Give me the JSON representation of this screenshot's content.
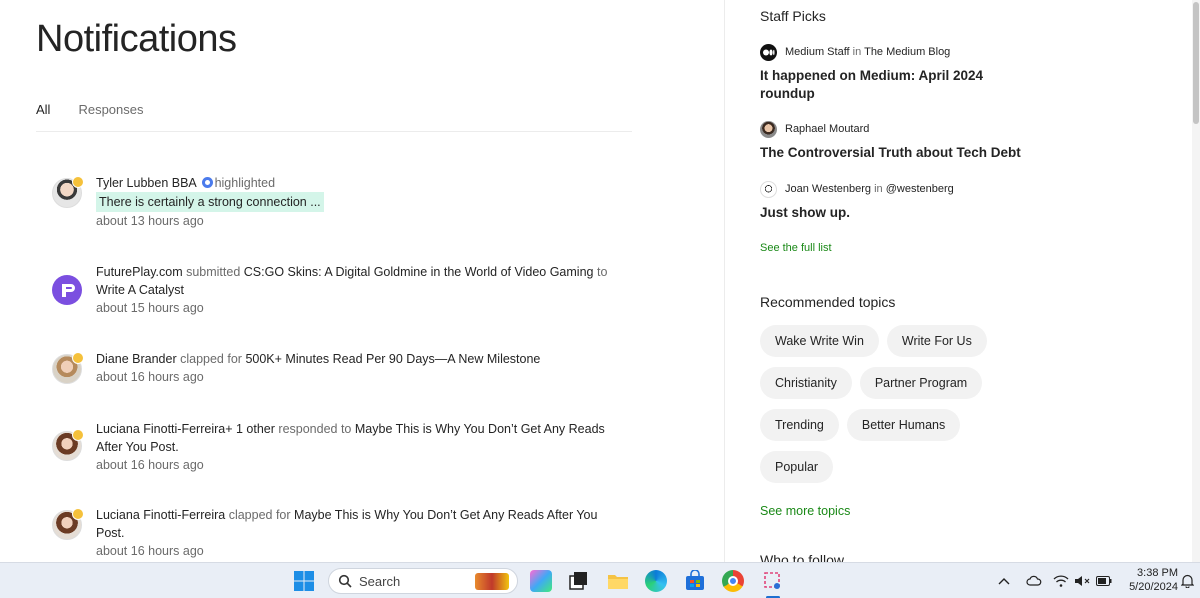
{
  "page": {
    "title": "Notifications"
  },
  "tabs": [
    {
      "label": "All"
    },
    {
      "label": "Responses"
    }
  ],
  "notifications": [
    {
      "actor": "Tyler Lubben BBA",
      "action": "highlighted",
      "highlight": "There is certainly a strong connection ...",
      "time": "about 13 hours ago"
    },
    {
      "actor": "FuturePlay.com",
      "action": "submitted",
      "post": "CS:GO Skins: A Digital Goldmine in the World of Video Gaming",
      "connector": "to",
      "target": "Write A Catalyst",
      "time": "about 15 hours ago"
    },
    {
      "actor": "Diane Brander",
      "action": "clapped for",
      "post": "500K+ Minutes Read Per 90 Days—A New Milestone",
      "time": "about 16 hours ago"
    },
    {
      "actor": "Luciana Finotti-Ferreira",
      "extra": "+ 1 other",
      "action": "responded to",
      "post": "Maybe This is Why You Don’t Get Any Reads After You Post.",
      "time": "about 16 hours ago"
    },
    {
      "actor": "Luciana Finotti-Ferreira",
      "action": "clapped for",
      "post": "Maybe This is Why You Don’t Get Any Reads After You Post.",
      "time": "about 16 hours ago"
    }
  ],
  "sidebar": {
    "staff_picks_heading": "Staff Picks",
    "picks": [
      {
        "author": "Medium Staff",
        "in": "in",
        "publication": "The Medium Blog",
        "title": "It happened on Medium: April 2024 roundup"
      },
      {
        "author": "Raphael Moutard",
        "title": "The Controversial Truth about Tech Debt"
      },
      {
        "author": "Joan Westenberg",
        "in": "in",
        "publication": "@westenberg",
        "title": "Just show up."
      }
    ],
    "see_full_list": "See the full list",
    "recommended_heading": "Recommended topics",
    "topics": [
      "Wake Write Win",
      "Write For Us",
      "Christianity",
      "Partner Program",
      "Trending",
      "Better Humans",
      "Popular"
    ],
    "see_more_topics": "See more topics",
    "cut_off_heading": "Who to follow"
  },
  "taskbar": {
    "search_label": "Search",
    "time": "3:38 PM",
    "date": "5/20/2024"
  },
  "colors": {
    "accent_green": "#1a8917",
    "highlight": "#d4f5e9",
    "chip_bg": "#f2f2f2"
  }
}
